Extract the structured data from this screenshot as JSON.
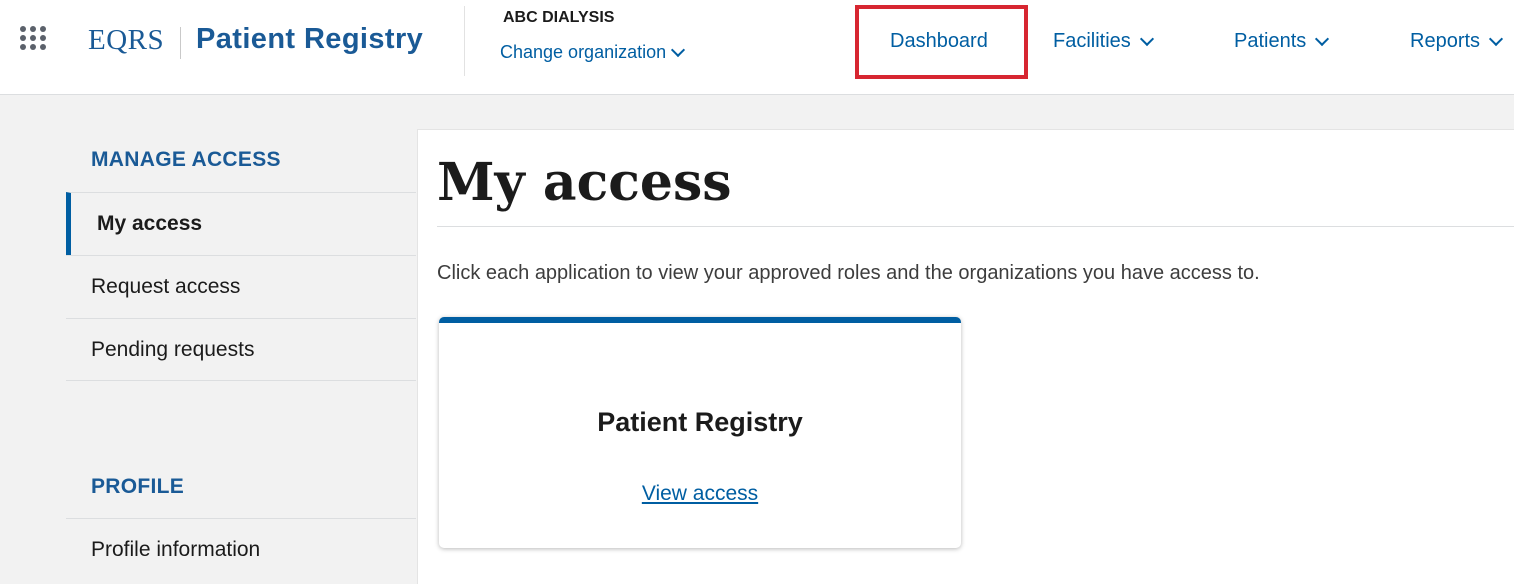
{
  "header": {
    "brand_short": "EQRS",
    "brand_app": "Patient Registry",
    "org_name": "ABC DIALYSIS",
    "org_change_label": "Change organization",
    "nav": {
      "dashboard": "Dashboard",
      "facilities": "Facilities",
      "patients": "Patients",
      "reports": "Reports"
    },
    "highlight_color": "#d72631"
  },
  "sidebar": {
    "manage_access_heading": "MANAGE ACCESS",
    "items": [
      {
        "label": "My access",
        "active": true
      },
      {
        "label": "Request access",
        "active": false
      },
      {
        "label": "Pending requests",
        "active": false
      }
    ],
    "profile_heading": "PROFILE",
    "profile_items": [
      {
        "label": "Profile information"
      }
    ]
  },
  "main": {
    "title": "My access",
    "intro": "Click each application to view your approved roles and the organizations you have access to.",
    "card": {
      "title": "Patient Registry",
      "link_label": "View access"
    }
  },
  "colors": {
    "brand_blue": "#1a5a96",
    "link_blue": "#005ea2",
    "page_bg": "#f2f2f2"
  },
  "icons": {
    "app_grid": "app-grid-icon",
    "chevron": "chevron-down-icon"
  }
}
